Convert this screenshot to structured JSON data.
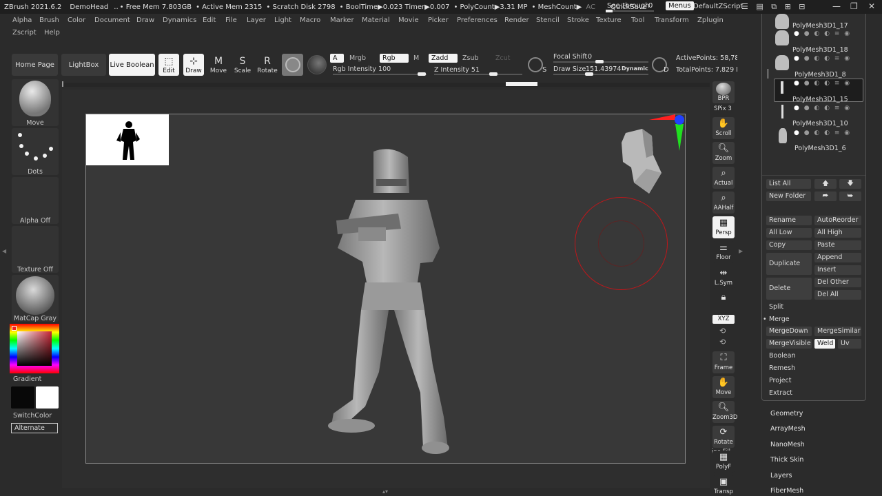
{
  "titlebar": {
    "app": "ZBrush 2021.6.2",
    "document": "DemoHead",
    "dots": "..",
    "free_mem": "• Free Mem 7.803GB",
    "active_mem": "• Active Mem 2315",
    "scratch": "• Scratch Disk 2798",
    "boottime": "• BoolTime▶0.023 Timer▶0.007",
    "polycount": "• PolyCount▶3.31 MP",
    "meshcount": "• MeshCount▶",
    "ac": "AC",
    "quicksave": "QuickSave",
    "see_through": "See-through",
    "see_through_val": "0",
    "menus": "Menus",
    "zscript": "DefaultZScript"
  },
  "menu_row1": [
    "Alpha",
    "Brush",
    "Color",
    "Document",
    "Draw",
    "Dynamics",
    "Edit",
    "File",
    "Layer",
    "Light",
    "Macro",
    "Marker",
    "Material",
    "Movie",
    "Picker",
    "Preferences",
    "Render",
    "Stencil",
    "Stroke",
    "Texture",
    "Tool",
    "Transform",
    "Zplugin"
  ],
  "menu_row2": [
    "Zscript",
    "Help"
  ],
  "toolbar": {
    "home": "Home Page",
    "lightbox": "LightBox",
    "live_boolean": "Live Boolean",
    "edit": "Edit",
    "draw": "Draw",
    "move": "Move",
    "scale": "Scale",
    "rotate": "Rotate",
    "a": "A",
    "mrgb": "Mrgb",
    "rgb": "Rgb",
    "m": "M",
    "zadd": "Zadd",
    "zsub": "Zsub",
    "zcut": "Zcut",
    "rgb_intensity": "Rgb Intensity 100",
    "z_intensity": "Z Intensity 51",
    "focal_shift_label": "Focal Shift",
    "focal_shift_val": "0",
    "draw_size_label": "Draw Size",
    "draw_size_val": "151.43974",
    "dynamic": "Dynamic",
    "s_label": "S",
    "d_label": "D",
    "active_points": "ActivePoints: 58,78",
    "total_points": "TotalPoints: 7.829 I"
  },
  "left_panel": {
    "brush": "Move",
    "stroke": "Dots",
    "alpha": "Alpha Off",
    "texture": "Texture Off",
    "material": "MatCap Gray",
    "gradient": "Gradient",
    "switchcolor": "SwitchColor",
    "alternate": "Alternate"
  },
  "right_strip": {
    "bpr": "BPR",
    "spix": "SPix 3",
    "scroll": "Scroll",
    "zoom": "Zoom",
    "actual": "Actual",
    "aahalf": "AAHalf",
    "persp": "Persp",
    "floor": "Floor",
    "lsym": "L.Sym",
    "xyz": "XYZ",
    "frame": "Frame",
    "move": "Move",
    "zoom3d": "Zoom3D",
    "rotate": "Rotate",
    "line_fill": "ine Fill",
    "polyf": "PolyF",
    "transp": "Transp"
  },
  "subtools": [
    {
      "name": "PolyMesh3D1_17"
    },
    {
      "name": "PolyMesh3D1_18"
    },
    {
      "name": "PolyMesh3D1_8"
    },
    {
      "name": "PolyMesh3D1_15"
    },
    {
      "name": "PolyMesh3D1_10"
    },
    {
      "name": "PolyMesh3D1_6"
    }
  ],
  "subtool_panel": {
    "list_all": "List All",
    "new_folder": "New Folder",
    "rename": "Rename",
    "autoreorder": "AutoReorder",
    "all_low": "All Low",
    "all_high": "All High",
    "copy": "Copy",
    "paste": "Paste",
    "duplicate": "Duplicate",
    "append": "Append",
    "insert": "Insert",
    "delete": "Delete",
    "del_other": "Del Other",
    "del_all": "Del All",
    "split": "Split",
    "merge": "Merge",
    "mergedown": "MergeDown",
    "mergesimilar": "MergeSimilar",
    "mergevisible": "MergeVisible",
    "weld": "Weld",
    "uv": "Uv",
    "boolean": "Boolean",
    "remesh": "Remesh",
    "project": "Project",
    "extract": "Extract"
  },
  "tool_menu": [
    "Geometry",
    "ArrayMesh",
    "NanoMesh",
    "Thick Skin",
    "Layers",
    "FiberMesh"
  ],
  "colors": {
    "background": "#2b2b2b",
    "canvas": "#383838",
    "brush_ring": "#c0161a",
    "axis_red": "#ff2020",
    "axis_green": "#20e020",
    "axis_blue": "#2040ff"
  }
}
